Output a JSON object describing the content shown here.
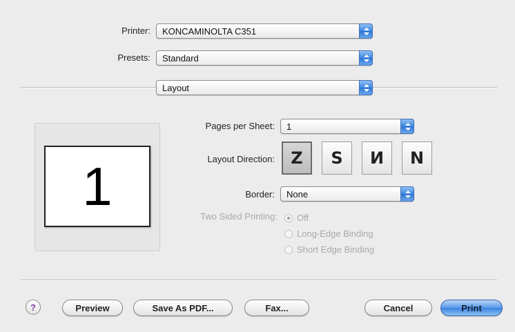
{
  "printer": {
    "label": "Printer:",
    "value": "KONCAMINOLTA C351"
  },
  "presets": {
    "label": "Presets:",
    "value": "Standard"
  },
  "panel": {
    "value": "Layout"
  },
  "preview": {
    "page_number": "1"
  },
  "layout": {
    "pages_per_sheet": {
      "label": "Pages per Sheet:",
      "value": "1"
    },
    "direction": {
      "label": "Layout Direction:",
      "options": [
        {
          "glyph": "Z",
          "selected": true
        },
        {
          "glyph": "S",
          "selected": false
        },
        {
          "glyph": "И",
          "selected": false
        },
        {
          "glyph": "N",
          "selected": false
        }
      ]
    },
    "border": {
      "label": "Border:",
      "value": "None"
    },
    "two_sided": {
      "label": "Two Sided Printing:",
      "options": [
        "Off",
        "Long-Edge Binding",
        "Short Edge Binding"
      ],
      "selected": "Off"
    }
  },
  "buttons": {
    "help": "?",
    "preview": "Preview",
    "save_pdf": "Save As PDF...",
    "fax": "Fax...",
    "cancel": "Cancel",
    "print": "Print"
  },
  "colors": {
    "accent": "#3d86e0",
    "disabled_text": "#a8a8a8",
    "help_icon": "#7a3aa8"
  }
}
